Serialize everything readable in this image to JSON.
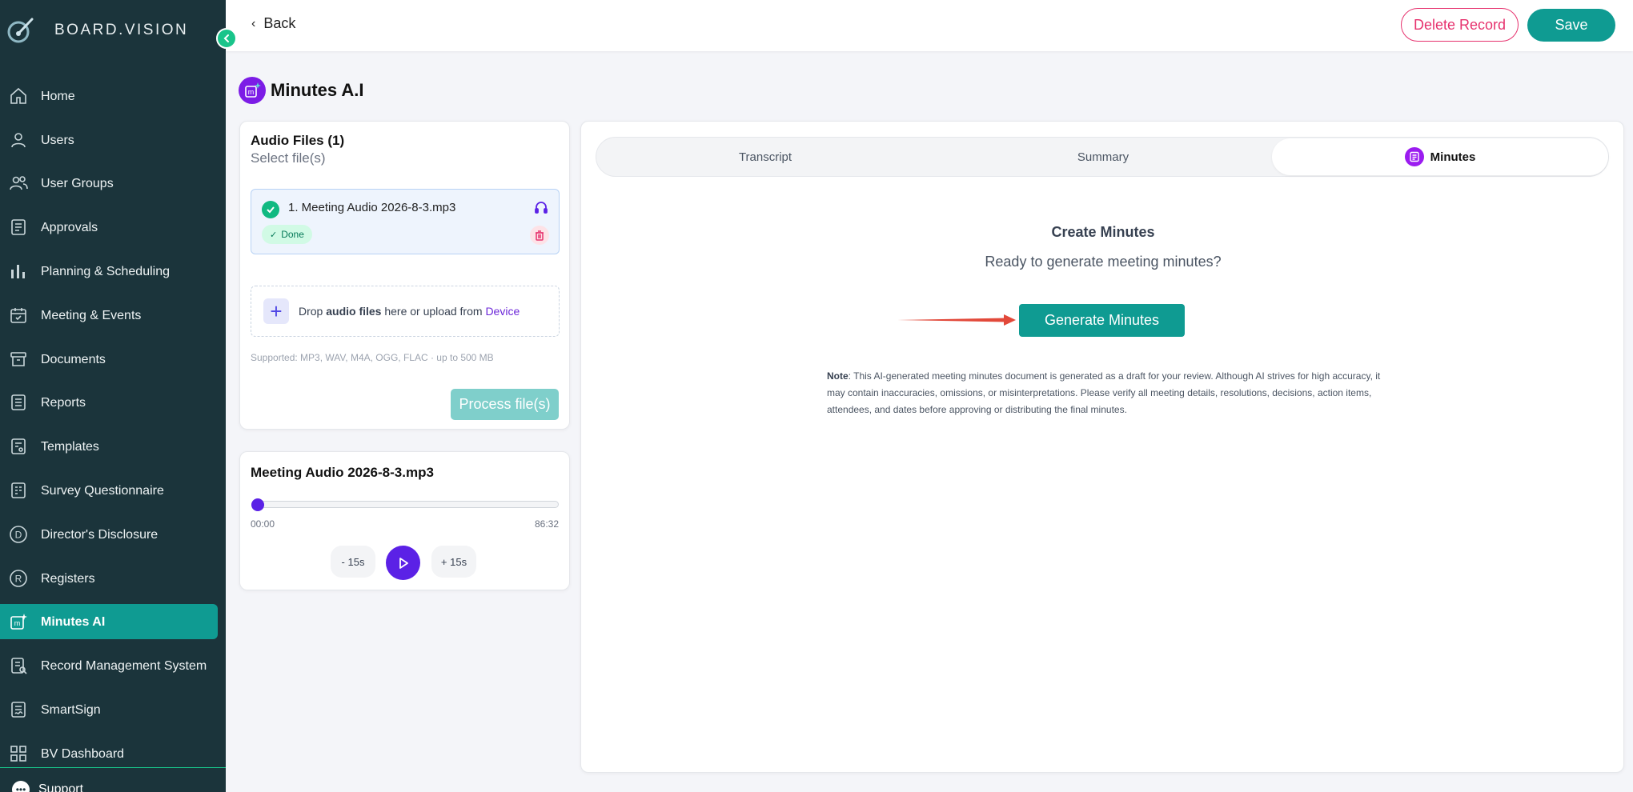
{
  "brand": {
    "name": "BOARD.VISION"
  },
  "sidebar": {
    "items": [
      {
        "label": "Home",
        "icon": "home-icon"
      },
      {
        "label": "Users",
        "icon": "user-icon"
      },
      {
        "label": "User Groups",
        "icon": "user-group-icon"
      },
      {
        "label": "Approvals",
        "icon": "approvals-icon"
      },
      {
        "label": "Planning & Scheduling",
        "icon": "bar-chart-icon"
      },
      {
        "label": "Meeting & Events",
        "icon": "calendar-icon"
      },
      {
        "label": "Documents",
        "icon": "archive-icon"
      },
      {
        "label": "Reports",
        "icon": "report-icon"
      },
      {
        "label": "Templates",
        "icon": "template-icon"
      },
      {
        "label": "Survey Questionnaire",
        "icon": "survey-icon"
      },
      {
        "label": "Director's Disclosure",
        "icon": "letter-d-icon"
      },
      {
        "label": "Registers",
        "icon": "letter-r-icon"
      },
      {
        "label": "Minutes AI",
        "icon": "minutes-ai-icon",
        "active": true
      },
      {
        "label": "Record Management System",
        "icon": "record-search-icon"
      },
      {
        "label": "SmartSign",
        "icon": "sign-icon"
      },
      {
        "label": "BV Dashboard",
        "icon": "dashboard-grid-icon"
      }
    ],
    "support_label": "Support"
  },
  "topbar": {
    "back_label": "Back",
    "delete_label": "Delete Record",
    "save_label": "Save"
  },
  "page": {
    "title": "Minutes A.I"
  },
  "audio_files": {
    "title": "Audio Files (1)",
    "subtitle": "Select file(s)",
    "file": {
      "name": "1. Meeting Audio 2026-8-3.mp3",
      "status": "Done"
    },
    "dropzone": {
      "prefix": "Drop ",
      "bold": "audio files",
      "middle": " here or upload from ",
      "link": "Device"
    },
    "supported": "Supported: MP3, WAV, M4A, OGG, FLAC · up to 500 MB",
    "process_label": "Process file(s)"
  },
  "player": {
    "title": "Meeting Audio 2026-8-3.mp3",
    "current_time": "00:00",
    "duration": "86:32",
    "progress": 0,
    "skip_back_label": "- 15s",
    "skip_forward_label": "+ 15s"
  },
  "tabs": [
    {
      "label": "Transcript"
    },
    {
      "label": "Summary"
    },
    {
      "label": "Minutes",
      "active": true
    }
  ],
  "minutes": {
    "heading": "Create Minutes",
    "subheading": "Ready to generate meeting minutes?",
    "generate_label": "Generate Minutes",
    "note_label": "Note",
    "note_text": ": This AI-generated meeting minutes document is generated as a draft for your review. Although AI strives for high accuracy, it may contain inaccuracies, omissions, or misinterpretations. Please verify all meeting details, resolutions, decisions, action items, attendees, and dates before approving or distributing the final minutes."
  },
  "colors": {
    "sidebar_bg": "#1b343b",
    "accent_teal": "#0f9b92",
    "accent_purple": "#5b21e6",
    "danger": "#e6326e",
    "success": "#10b981"
  }
}
